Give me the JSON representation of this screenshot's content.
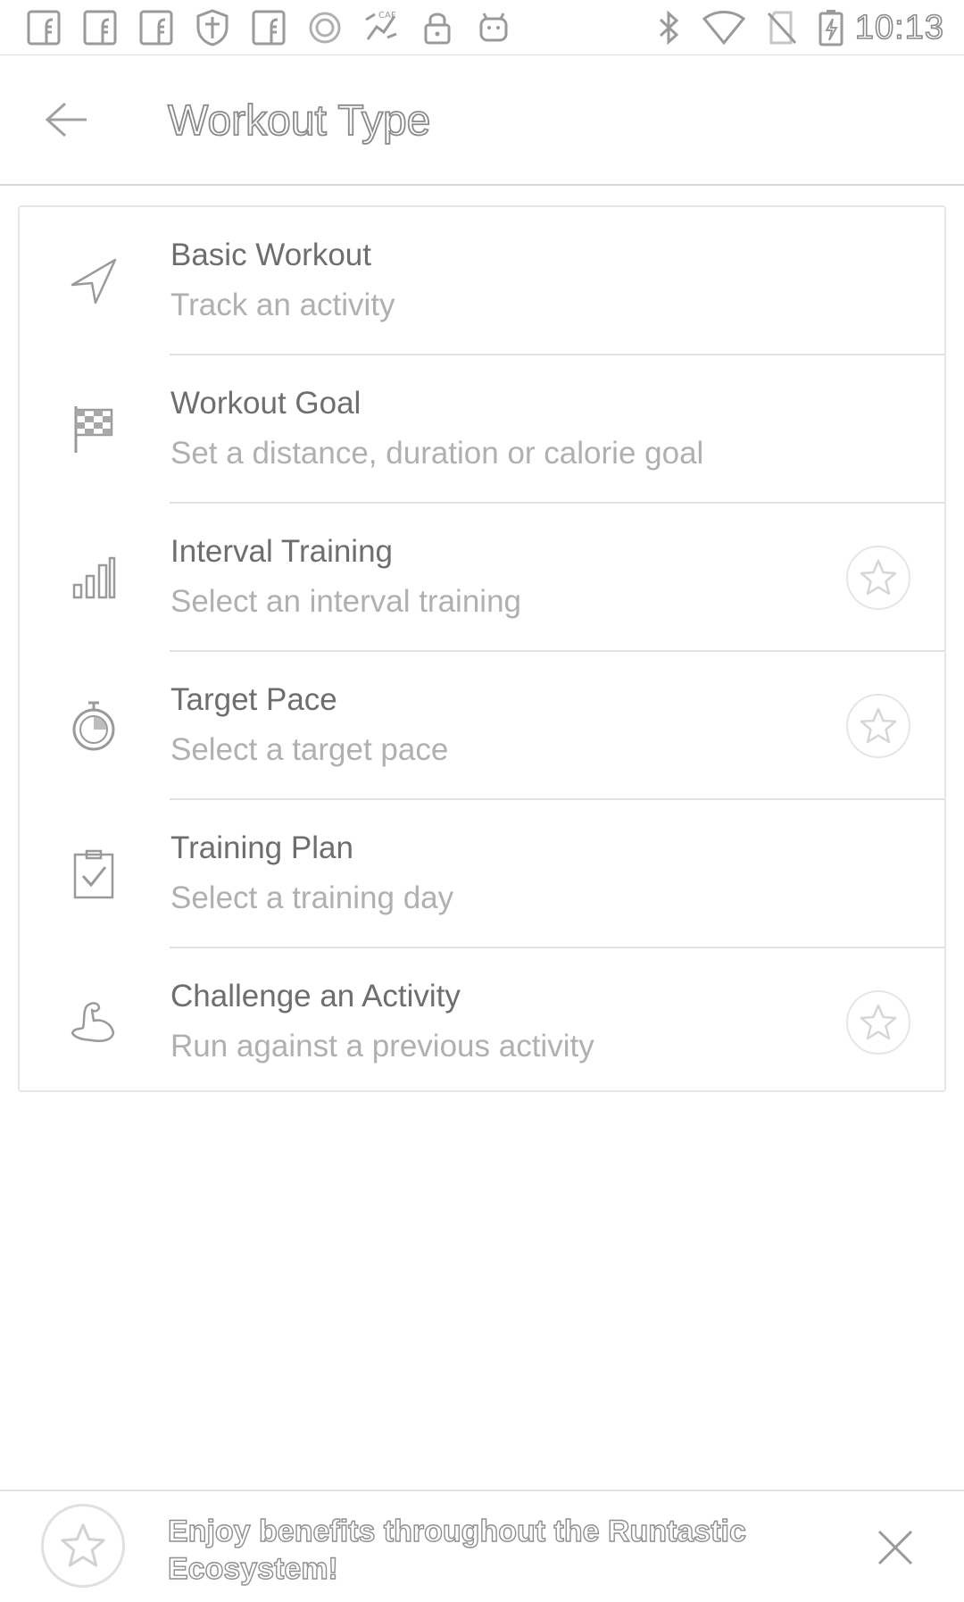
{
  "status_bar": {
    "left_icons": [
      "facebook-icon",
      "facebook-icon",
      "facebook-icon",
      "shield-icon",
      "facebook-icon",
      "circle-icon",
      "fitness-app-icon",
      "lock-icon",
      "android-icon"
    ],
    "right_icons": [
      "bluetooth-icon",
      "wifi-icon",
      "no-sim-icon",
      "battery-charging-icon"
    ],
    "time": "10:13"
  },
  "app_bar": {
    "title": "Workout Type",
    "back_icon": "arrow-back-icon"
  },
  "workout_types": [
    {
      "title": "Basic Workout",
      "subtitle": "Track an activity",
      "icon": "navigation-icon",
      "premium": false
    },
    {
      "title": "Workout Goal",
      "subtitle": "Set a distance, duration or calorie goal",
      "icon": "checkered-flag-icon",
      "premium": false
    },
    {
      "title": "Interval Training",
      "subtitle": "Select an interval training",
      "icon": "bars-icon",
      "premium": true
    },
    {
      "title": "Target Pace",
      "subtitle": "Select a target pace",
      "icon": "stopwatch-icon",
      "premium": true
    },
    {
      "title": "Training Plan",
      "subtitle": "Select a training day",
      "icon": "clipboard-check-icon",
      "premium": false
    },
    {
      "title": "Challenge an Activity",
      "subtitle": "Run against a previous activity",
      "icon": "flexed-arm-icon",
      "premium": true
    }
  ],
  "banner": {
    "text": "Enjoy benefits throughout the Runtastic Ecosystem!",
    "icon": "star-icon",
    "close_icon": "close-icon"
  },
  "colors": {
    "title_text": "#6e6e6e",
    "subtitle_text": "#b0b0b0",
    "divider": "#e3e3e3",
    "icon_stroke": "#9a9a9a"
  }
}
